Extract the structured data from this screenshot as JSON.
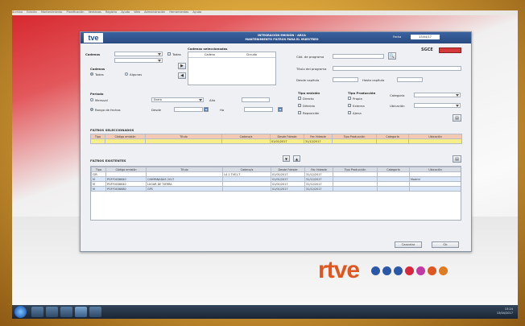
{
  "menubar": {
    "items": [
      "Archivo",
      "Edición",
      "Mantenimiento",
      "Planificación",
      "Ventanas",
      "Registro",
      "Ayuda",
      "Web",
      "Administración",
      "Herramientas",
      "Ayuda"
    ]
  },
  "app": {
    "logo": "tve",
    "title_line1": "INTEGRACIÓN EMISIÓN - ARCA",
    "title_line2": "MANTENIMIENTO FILTROS PARA EL MUESTREO",
    "date_label": "Fecha",
    "date_value": "13/04/17",
    "sgce_label": "SGCE",
    "filters": {
      "cadenas_label": "Cadenas",
      "todas_label": "Todas",
      "cadenas_seleccionadas_label": "Cadenas seleccionadas",
      "cadena_col": "Cadena",
      "circuito_col": "Circuito",
      "cadenas2_label": "Cadenas",
      "radio_todas": "Todas",
      "radio_algunas": "Algunas",
      "periodo_label": "Periodo",
      "radio_mensual": "Mensual",
      "radio_rango": "Rango de fechas",
      "mes_value": "Enero",
      "ano_label": "Año",
      "desde_label": "Desde",
      "hasta_label": "Ha",
      "cod_programa_label": "Cód. de programa",
      "titulo_programa_label": "Título del programa",
      "desde_capitulo_label": "Desde capítulo",
      "hasta_capitulo_label": "Hasta capítulo",
      "tipo_emision_label": "Tipo emisión",
      "te_options": [
        "Directo",
        "Diferido",
        "Reposición"
      ],
      "tipo_produccion_label": "Tipo Producción",
      "tp_options": [
        "Propia",
        "Externa",
        "Ajena"
      ],
      "categoria_label": "Categoría",
      "ubicacion_label": "Ubicación"
    },
    "selected": {
      "title": "FILTROS SELECCIONADOS",
      "columns": [
        "Tipo",
        "Código emisión",
        "Título",
        "Cadena/s",
        "Desde Fdesde",
        "Fec Hdesde",
        "Tipo Producción",
        "Categoría",
        "Ubicación"
      ],
      "row": [
        "",
        "",
        "",
        "",
        "01/01/2017",
        "31/12/2017",
        "",
        "",
        ""
      ]
    },
    "existing": {
      "title": "FILTROS EXISTENTES",
      "columns": [
        "Tipo",
        "Código emisión",
        "Título",
        "Cadena/s",
        "Desde Fdesde",
        "Fec Hdesde",
        "Tipo Producción",
        "Categoría",
        "Ubicación"
      ],
      "rows": [
        [
          "CIR",
          "",
          "",
          "LA 1 TVE1-T",
          "01/01/2017",
          "31/12/2017",
          "",
          "",
          ""
        ],
        [
          "M",
          "PGFF0036640",
          "CAMPANADAS 2017",
          "",
          "01/01/2017",
          "31/12/2017",
          "",
          "",
          "Madrid"
        ],
        [
          "M",
          "PGFF0036640",
          "LUGAR DE TIERRA",
          "",
          "01/01/2017",
          "31/12/2017",
          "",
          "",
          ""
        ],
        [
          "M",
          "PGFF0036880",
          "GPS",
          "",
          "01/01/2017",
          "31/12/2017",
          "",
          "",
          ""
        ]
      ]
    },
    "buttons": {
      "cancel": "Cancelar",
      "ok": "Ok"
    }
  },
  "brand": {
    "logo_text": "rtve"
  },
  "taskbar": {
    "time": "13:24",
    "date": "13/04/2017"
  }
}
